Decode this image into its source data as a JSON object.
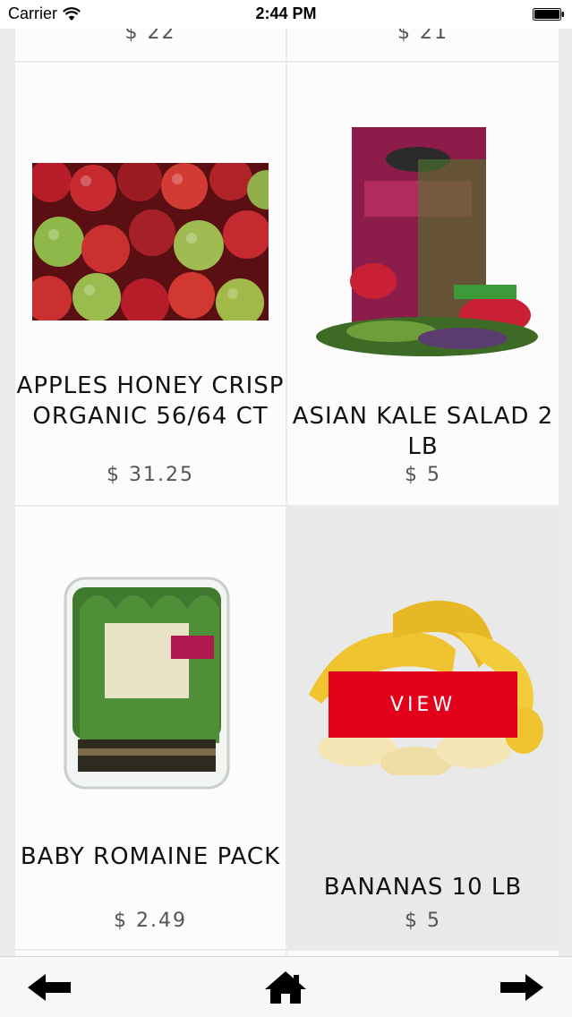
{
  "status_bar": {
    "carrier": "Carrier",
    "time": "2:44 PM"
  },
  "top_row": {
    "left_price": "$ 22",
    "right_price": "$ 21"
  },
  "products": [
    {
      "name": "APPLES HONEY CRISP ORGANIC 56/64 CT",
      "price": "$ 31.25",
      "image": "apples-image"
    },
    {
      "name": "ASIAN KALE SALAD 2 LB",
      "price": "$ 5",
      "image": "kale-salad-image"
    },
    {
      "name": "BABY ROMAINE PACK",
      "price": "$ 2.49",
      "image": "romaine-image"
    },
    {
      "name": "BANANAS 10 LB",
      "price": "$ 5",
      "image": "bananas-image"
    }
  ],
  "view_button_label": "VIEW",
  "toolbar": {
    "back_icon": "arrow-left-icon",
    "home_icon": "home-icon",
    "forward_icon": "arrow-right-icon"
  },
  "colors": {
    "accent_red": "#e3001b",
    "cell_bg": "#fcfcfc",
    "highlight_bg": "#e9e9e9"
  }
}
